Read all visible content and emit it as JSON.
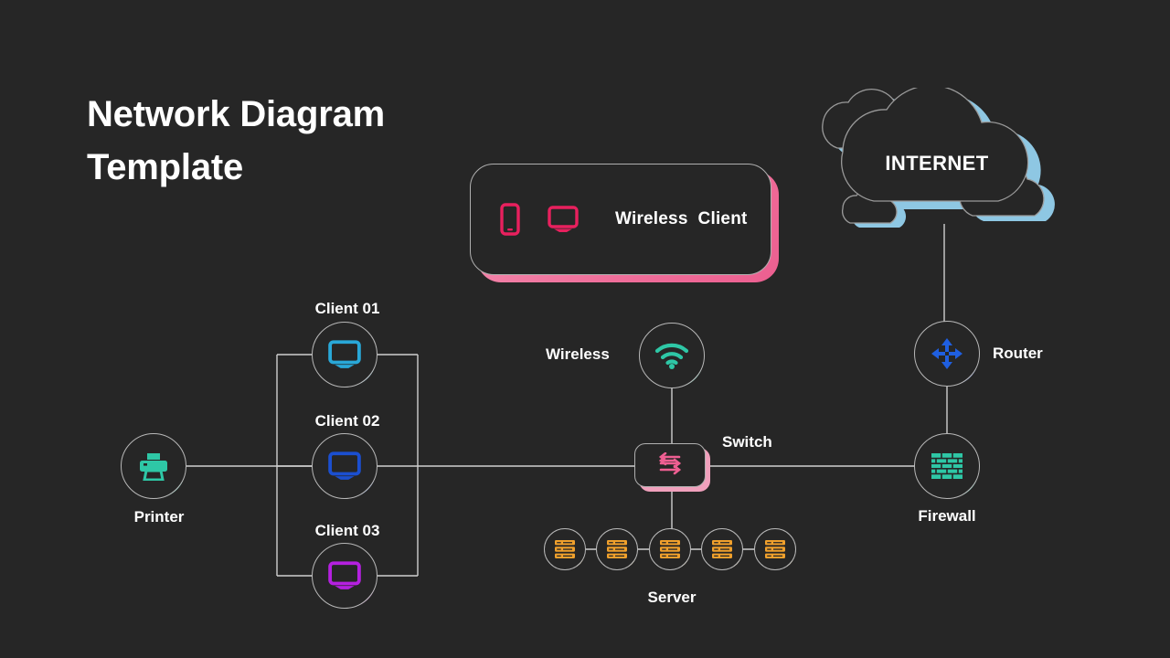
{
  "page": {
    "title": "Network Diagram\nTemplate",
    "background_color": "#262626"
  },
  "internet": {
    "label": "INTERNET",
    "outline_color": "#9a9a9a",
    "shadow_color": "#8ec7e3"
  },
  "wireless_client": {
    "label": "Wireless  Client",
    "icons": [
      "phone-icon",
      "monitor-icon"
    ],
    "icon_color": "#e8205e",
    "shadow_color": "#ef6e9a"
  },
  "nodes": {
    "printer": {
      "label": "Printer",
      "icon": "printer-icon",
      "color": "#2ec7a6"
    },
    "client01": {
      "label": "Client 01",
      "icon": "monitor-icon",
      "color": "#29a8d8"
    },
    "client02": {
      "label": "Client 02",
      "icon": "monitor-icon",
      "color": "#1b4fd0"
    },
    "client03": {
      "label": "Client 03",
      "icon": "monitor-icon",
      "color": "#b520e0"
    },
    "wireless": {
      "label": "Wireless",
      "icon": "wifi-icon",
      "color": "#2ec7a6"
    },
    "switch": {
      "label": "Switch",
      "icon": "switch-arrows-icon",
      "color": "#ef5f92"
    },
    "router": {
      "label": "Router",
      "icon": "four-arrows-icon",
      "color": "#1f5fe0"
    },
    "firewall": {
      "label": "Firewall",
      "icon": "brick-wall-icon",
      "color": "#2ec7a6"
    },
    "server": {
      "label": "Server",
      "icon": "server-rack-icon",
      "color": "#f0a02c",
      "count": 5
    }
  }
}
